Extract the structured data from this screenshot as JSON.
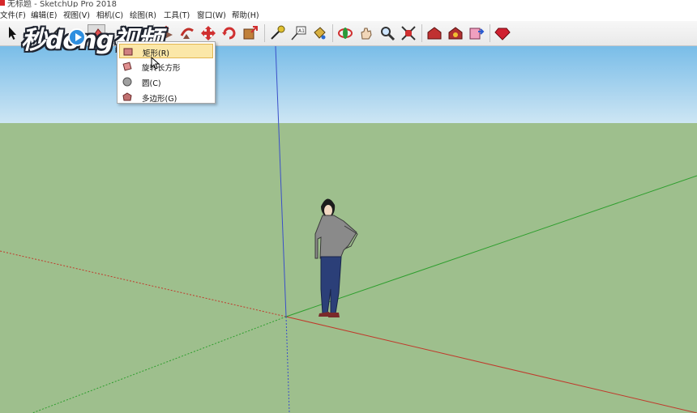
{
  "window": {
    "title": "无标题 - SketchUp Pro 2018"
  },
  "menubar": {
    "items": [
      {
        "label": "文件(F)"
      },
      {
        "label": "编辑(E)"
      },
      {
        "label": "视图(V)"
      },
      {
        "label": "相机(C)"
      },
      {
        "label": "绘图(R)"
      },
      {
        "label": "工具(T)"
      },
      {
        "label": "窗口(W)"
      },
      {
        "label": "帮助(H)"
      }
    ]
  },
  "toolbar": {
    "tools": [
      {
        "icon": "select-arrow-icon"
      },
      {
        "icon": "eraser-icon"
      },
      {
        "icon": "line-tool-icon"
      },
      {
        "icon": "arc-tool-icon"
      },
      {
        "icon": "shape-tool-icon"
      },
      {
        "icon": "push-pull-icon"
      },
      {
        "icon": "follow-me-icon"
      },
      {
        "icon": "move-icon"
      },
      {
        "icon": "rotate-icon"
      },
      {
        "icon": "scale-icon"
      },
      {
        "icon": "tape-measure-icon"
      },
      {
        "icon": "text-label-icon"
      },
      {
        "icon": "paint-bucket-icon"
      },
      {
        "icon": "orbit-icon"
      },
      {
        "icon": "pan-hand-icon"
      },
      {
        "icon": "zoom-icon"
      },
      {
        "icon": "zoom-extents-icon"
      },
      {
        "icon": "warehouse-icon"
      },
      {
        "icon": "extension-warehouse-icon"
      },
      {
        "icon": "send-to-layout-icon"
      },
      {
        "icon": "ruby-console-icon"
      }
    ]
  },
  "dropdown": {
    "items": [
      {
        "label": "矩形(R)",
        "icon": "rectangle-icon",
        "highlighted": true
      },
      {
        "label": "旋转长方形",
        "icon": "rotated-rectangle-icon",
        "highlighted": false
      },
      {
        "label": "圆(C)",
        "icon": "circle-icon",
        "highlighted": false
      },
      {
        "label": "多边形(G)",
        "icon": "polygon-icon",
        "highlighted": false
      }
    ]
  },
  "watermark": {
    "text": "秒dong视频"
  },
  "colors": {
    "sky_top": "#79bde8",
    "sky_horizon": "#cde6f4",
    "ground": "#9ebf8d",
    "red_axis": "#c0392b",
    "green_axis": "#2e9e2e",
    "blue_axis": "#3a4fc8",
    "menu_highlight": "#fbe7a8"
  }
}
